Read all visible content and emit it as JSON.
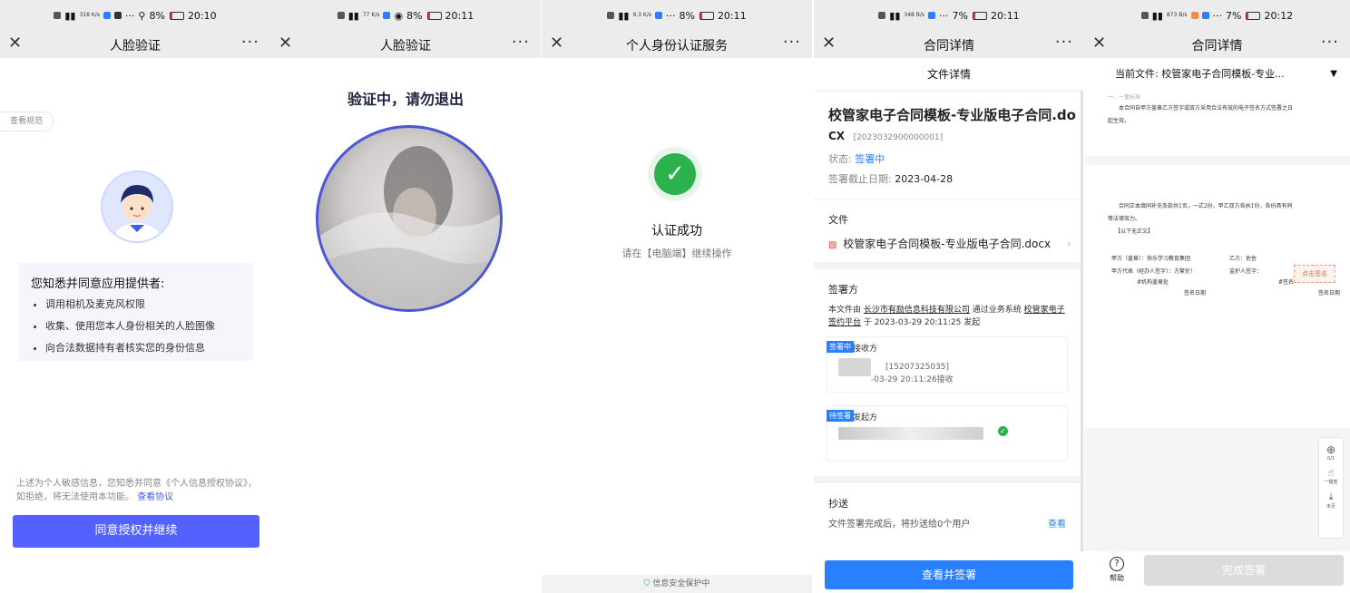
{
  "status_bars": [
    {
      "time": "20:10",
      "battery": "8%",
      "speed": "318 K/s"
    },
    {
      "time": "20:11",
      "battery": "8%",
      "speed": "77 K/s"
    },
    {
      "time": "20:11",
      "battery": "8%",
      "speed": "9.3 K/s"
    },
    {
      "time": "20:11",
      "battery": "7%",
      "speed": "348 B/s"
    },
    {
      "time": "20:12",
      "battery": "7%",
      "speed": "873 B/s"
    }
  ],
  "screen1": {
    "title": "人脸验证",
    "rule_tag": "查看规范",
    "consent_heading": "您知悉并同意应用提供者:",
    "consent_items": [
      "调用相机及麦克风权限",
      "收集、使用您本人身份相关的人脸图像",
      "向合法数据持有者核实您的身份信息"
    ],
    "notice_text": "上述为个人敏感信息，您知悉并同意《个人信息授权协议》，如拒绝，将无法使用本功能。",
    "notice_link": "查看协议",
    "agree_button": "同意授权并继续"
  },
  "screen2": {
    "title": "人脸验证",
    "verifying_text": "验证中，请勿退出"
  },
  "screen3": {
    "title": "个人身份认证服务",
    "success_title": "认证成功",
    "success_sub": "请在【电脑端】继续操作",
    "secure_text": "信息安全保护中"
  },
  "screen4": {
    "title": "合同详情",
    "subtitle": "文件详情",
    "doc_name": "校管家电子合同模板-专业版电子合同.do",
    "doc_code": "CX",
    "doc_number": "[2023032900000001]",
    "status_label": "状态:",
    "status_value": "签署中",
    "deadline_label": "签署截止日期:",
    "deadline_value": "2023-04-28",
    "file_section": "文件",
    "file_name": "校管家电子合同模板-专业版电子合同.docx",
    "signer_section": "签署方",
    "sign_desc_1": "本文件由",
    "sign_company": "长沙市有励信息科技有限公司",
    "sign_desc_2": "通过业务系统",
    "sign_system": "校管家电子签约平台",
    "sign_desc_3": "于 2023-03-29 20:11:25 发起",
    "party1_badge": "签署中",
    "party1_role": "接收方",
    "party1_phone": "[15207325035]",
    "party1_time": "-03-29 20:11:26接收",
    "party2_badge": "待签署",
    "party2_role": "发起方",
    "cc_section": "抄送",
    "cc_text": "文件签署完成后，将抄送给0个用户",
    "cc_link": "查看",
    "view_sign_button": "查看并签署"
  },
  "screen5": {
    "title": "合同详情",
    "current_file_label": "当前文件:",
    "current_file": "校管家电子合同模板-专业...",
    "page1_line1": "一、一量标准",
    "page1_line2": "本合同自甲方盖章乙方签字或双方采用合法有效的电子签名方式签署之日",
    "page1_line3": "起生效。",
    "page2_line1": "合同正本填同补充条款共1页，一式2份，甲乙双方各执1份，各份具有同",
    "page2_line2": "等法律效力。",
    "page2_line3": "【以下无正文】",
    "party_a": "甲方（盖章）：快乐学习教育集团",
    "party_b": "乙方：佐佐",
    "party_a_rep": "甲方代表（经办人签字）：方繁伦！",
    "guardian": "监护人签字：",
    "seal": "#机构盖章处",
    "sign_mark": "#签名",
    "sign_date_1": "签名日期",
    "sign_date_2": "签名日期",
    "click_sign": "点击签名",
    "tool1_label": "0/1",
    "tool2_label": "一键签",
    "tool3_label": "末页",
    "help_label": "帮助",
    "complete_button": "完成签署"
  }
}
